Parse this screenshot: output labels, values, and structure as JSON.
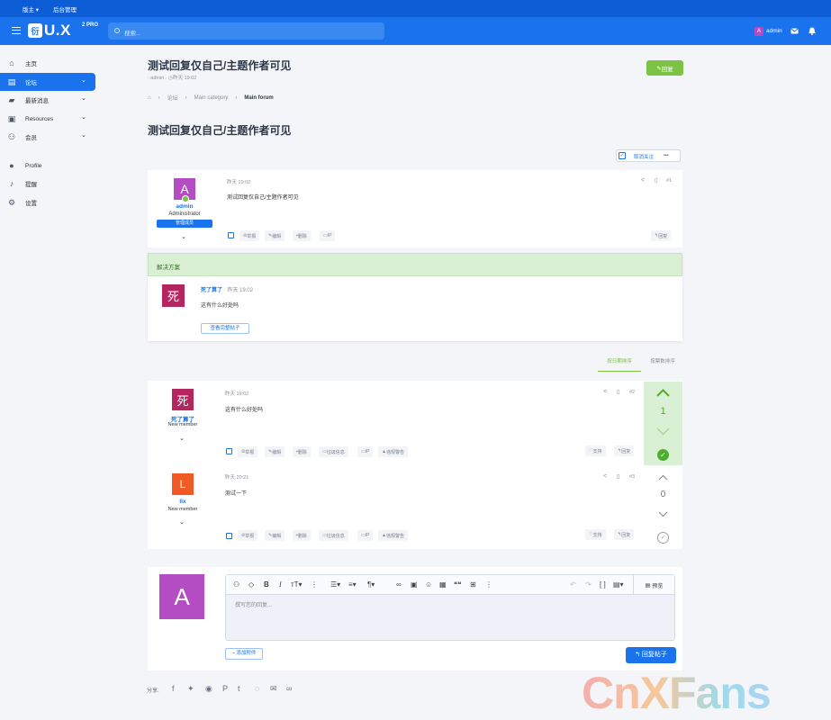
{
  "topbar": {
    "item1": "版主 ▾",
    "item2": "后台管理"
  },
  "header": {
    "logo_mark": "衍",
    "logo_text": "U.X",
    "logo_sup": "2 PRO",
    "search_placeholder": "搜索...",
    "avatar_letter": "A",
    "username": "admin",
    "mail_icon": "mail-icon",
    "bell_icon": "bell-icon"
  },
  "sidebar": {
    "items": [
      {
        "label": "主页",
        "icon": "home-icon"
      },
      {
        "label": "论坛",
        "icon": "forum-icon",
        "active": true
      },
      {
        "label": "最新消息",
        "icon": "chat-icon"
      },
      {
        "label": "Resources",
        "icon": "resources-icon"
      },
      {
        "label": "会员",
        "icon": "members-icon"
      },
      {
        "label": "Profile",
        "icon": "user-icon"
      },
      {
        "label": "提醒",
        "icon": "bell-icon"
      },
      {
        "label": "设置",
        "icon": "gear-icon"
      }
    ]
  },
  "page": {
    "title": "测试回复仅自己/主题作者可见",
    "meta_author": "admin",
    "meta_time": "昨天 19:02",
    "reply_button": "回复",
    "breadcrumb": [
      "论坛",
      "Main category",
      "Main forum"
    ],
    "heading": "测试回复仅自己/主题作者可见",
    "unwatch": "取消关注",
    "more": "•••"
  },
  "first_post": {
    "avatar_letter": "A",
    "username": "admin",
    "user_title": "Administrator",
    "banner": "管理成员",
    "time": "昨天 19:02",
    "number": "#1",
    "body": "测试回复仅自己/主题作者可见",
    "actions": [
      "举报",
      "编辑",
      "删除",
      "IP"
    ],
    "reply": "回复"
  },
  "solution": {
    "header": "解决方案",
    "avatar_char": "死",
    "author": "死了算了",
    "time": "· 昨天 19:02",
    "body": "这有什么好处吗",
    "view_button": "查看完整帖子"
  },
  "sort_tabs": {
    "by_date": "按日期排序",
    "by_votes": "按票数排序"
  },
  "posts": [
    {
      "avatar_char": "死",
      "username": "死了算了",
      "user_title": "New member",
      "time": "昨天 19:02",
      "number": "#2",
      "body": "这有什么好处吗",
      "votes": "1",
      "actions": [
        "举报",
        "编辑",
        "删除",
        "垃圾信息",
        "IP",
        "违规警告"
      ],
      "like": "支持",
      "reply": "回复"
    },
    {
      "avatar_char": "L",
      "username": "llx",
      "user_title": "New member",
      "time": "昨天 20:21",
      "number": "#3",
      "body": "测试一下",
      "votes": "0",
      "actions": [
        "举报",
        "编辑",
        "删除",
        "垃圾信息",
        "IP",
        "违规警告"
      ],
      "like": "支持",
      "reply": "回复"
    }
  ],
  "editor": {
    "avatar_letter": "A",
    "placeholder": "撰写您的回复...",
    "preview": "预览",
    "attach": "添加附件",
    "submit": "回复帖子"
  },
  "share": {
    "label": "分享:"
  },
  "watermark": "CnXFans",
  "colors": {
    "primary": "#1a73ec",
    "topbar": "#0c5dd5",
    "success": "#7cc243",
    "solution_bg": "#d9f0d4"
  }
}
